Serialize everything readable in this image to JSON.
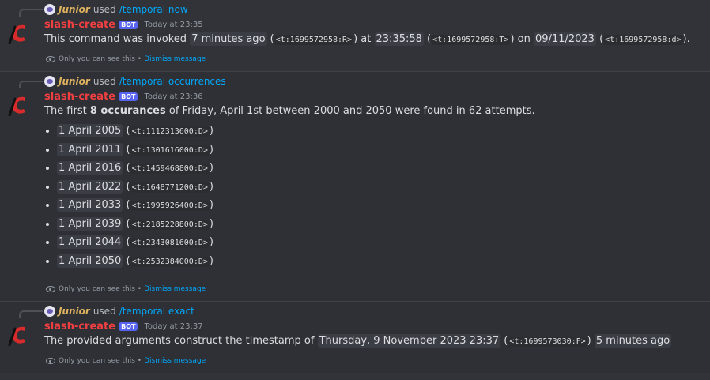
{
  "colors": {
    "background": "#313338",
    "author": "#f23f42",
    "invoker": "#e0b35f",
    "link": "#00a8fc",
    "bot_badge": "#5865f2"
  },
  "messages": [
    {
      "reply": {
        "name": "Junior",
        "used": "used",
        "command": "/temporal now"
      },
      "author": "slash-create",
      "bot_badge": "BOT",
      "timestamp": "Today at 23:35",
      "content": {
        "t1": "This command was invoked",
        "chip1": "7 minutes ago",
        "code1": "<t:1699572958:R>",
        "t2": "at",
        "chip2": "23:35:58",
        "code2": "<t:1699572958:T>",
        "t3": "on",
        "chip3": "09/11/2023",
        "code3": "<t:1699572958:d>"
      },
      "ephemeral": {
        "text": "Only you can see this •",
        "dismiss": "Dismiss message"
      }
    },
    {
      "reply": {
        "name": "Junior",
        "used": "used",
        "command": "/temporal occurrences"
      },
      "author": "slash-create",
      "bot_badge": "BOT",
      "timestamp": "Today at 23:36",
      "content": {
        "prefix": "The first",
        "bold": "8 occurances",
        "suffix": "of Friday, April 1st between 2000 and 2050 were found in 62 attempts.",
        "items": [
          {
            "date": "1 April 2005",
            "code": "<t:1112313600:D>"
          },
          {
            "date": "1 April 2011",
            "code": "<t:1301616000:D>"
          },
          {
            "date": "1 April 2016",
            "code": "<t:1459468800:D>"
          },
          {
            "date": "1 April 2022",
            "code": "<t:1648771200:D>"
          },
          {
            "date": "1 April 2033",
            "code": "<t:1995926400:D>"
          },
          {
            "date": "1 April 2039",
            "code": "<t:2185228800:D>"
          },
          {
            "date": "1 April 2044",
            "code": "<t:2343081600:D>"
          },
          {
            "date": "1 April 2050",
            "code": "<t:2532384000:D>"
          }
        ]
      },
      "ephemeral": {
        "text": "Only you can see this •",
        "dismiss": "Dismiss message"
      }
    },
    {
      "reply": {
        "name": "Junior",
        "used": "used",
        "command": "/temporal exact"
      },
      "author": "slash-create",
      "bot_badge": "BOT",
      "timestamp": "Today at 23:37",
      "content": {
        "t1": "The provided arguments construct the timestamp of",
        "chip1": "Thursday, 9 November 2023 23:37",
        "code1": "<t:1699573030:F>",
        "chip2": "5 minutes ago"
      },
      "ephemeral": {
        "text": "Only you can see this •",
        "dismiss": "Dismiss message"
      }
    }
  ]
}
